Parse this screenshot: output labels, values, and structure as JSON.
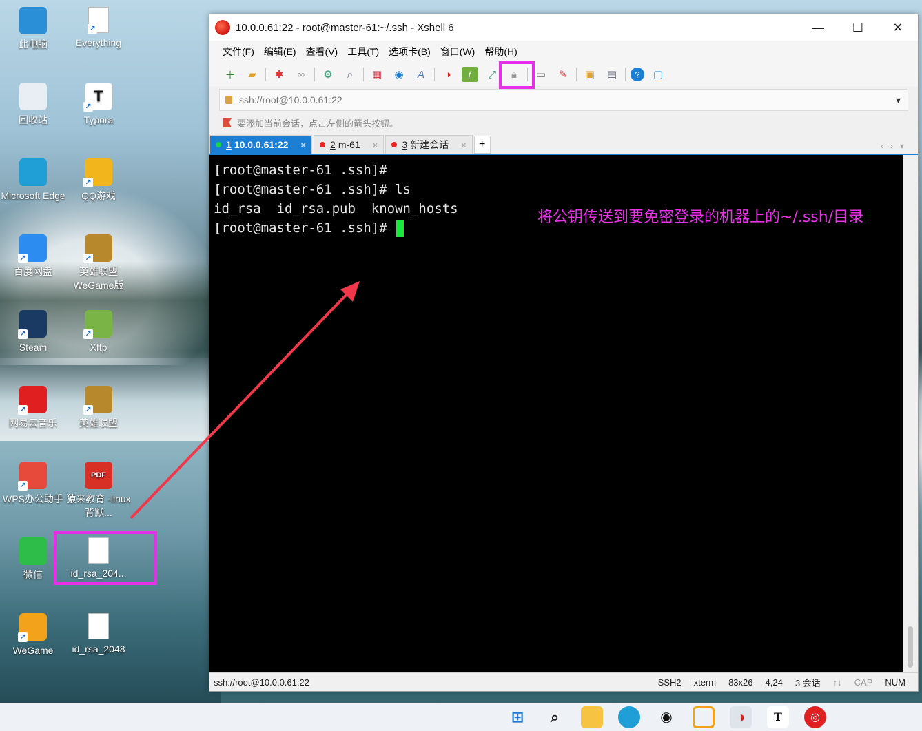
{
  "desktop": {
    "icons": [
      {
        "label": "此电脑",
        "icon": "computer-icon",
        "color": "#2b8fd8"
      },
      {
        "label": "Everything",
        "icon": "document-icon",
        "color": "#ffffff"
      },
      {
        "label": "回收站",
        "icon": "recycle-bin-icon",
        "color": "#e8eef4"
      },
      {
        "label": "Typora",
        "icon": "typora-icon",
        "color": "#ffffff",
        "glyph": "T"
      },
      {
        "label": "Microsoft Edge",
        "icon": "edge-icon",
        "color": "#1f9fd6"
      },
      {
        "label": "QQ游戏",
        "icon": "qq-game-icon",
        "color": "#f2b51b"
      },
      {
        "label": "百度网盘",
        "icon": "baidu-netdisk-icon",
        "color": "#2d8cf0"
      },
      {
        "label": "英雄联盟 WeGame版",
        "icon": "league-icon",
        "color": "#b8892c"
      },
      {
        "label": "Steam",
        "icon": "steam-icon",
        "color": "#1b3a63"
      },
      {
        "label": "Xftp",
        "icon": "xftp-icon",
        "color": "#7bb446"
      },
      {
        "label": "网易云音乐",
        "icon": "netease-music-icon",
        "color": "#e02020"
      },
      {
        "label": "英雄联盟",
        "icon": "league-icon",
        "color": "#b8892c"
      },
      {
        "label": "WPS办公助手",
        "icon": "wps-icon",
        "color": "#e74a3b"
      },
      {
        "label": "猿来教育 -linux背默...",
        "icon": "pdf-icon",
        "color": "#d93025",
        "glyph": "PDF"
      },
      {
        "label": "微信",
        "icon": "wechat-icon",
        "color": "#2fbd4a"
      },
      {
        "label": "id_rsa_204...",
        "icon": "file-icon",
        "color": "#ffffff"
      },
      {
        "label": "WeGame",
        "icon": "wegame-icon",
        "color": "#f2a21b"
      },
      {
        "label": "id_rsa_2048",
        "icon": "file-icon",
        "color": "#ffffff"
      }
    ]
  },
  "window": {
    "title": "10.0.0.61:22 - root@master-61:~/.ssh - Xshell 6",
    "minimize": "—",
    "maximize": "☐",
    "close": "✕"
  },
  "menu": [
    "文件(F)",
    "编辑(E)",
    "查看(V)",
    "工具(T)",
    "选项卡(B)",
    "窗口(W)",
    "帮助(H)"
  ],
  "address": {
    "value": "ssh://root@10.0.0.61:22",
    "dropdown": "▾"
  },
  "hint": "要添加当前会话，点击左侧的箭头按钮。",
  "tabs": [
    {
      "num": "1",
      "label": "10.0.0.61:22",
      "close": "×"
    },
    {
      "num": "2",
      "label": "m-61",
      "close": "×"
    },
    {
      "num": "3",
      "label": "新建会话",
      "close": "×"
    },
    {
      "add": "+"
    }
  ],
  "terminal": {
    "lines": [
      "[root@master-61 .ssh]#",
      "[root@master-61 .ssh]# ls",
      "id_rsa  id_rsa.pub  known_hosts",
      "[root@master-61 .ssh]# "
    ]
  },
  "annotation": "将公钥传送到要免密登录的机器上的~/.ssh/目录",
  "status": {
    "left": "ssh://root@10.0.0.61:22",
    "protocol": "SSH2",
    "term": "xterm",
    "size": "83x26",
    "pos": "4,24",
    "sessions": "3 会话",
    "cap": "CAP",
    "num": "NUM"
  },
  "colors": {
    "accent": "#1c7fd6",
    "highlight": "#e62fe6",
    "arrow": "#f0384a",
    "cursor": "#16e83e"
  }
}
